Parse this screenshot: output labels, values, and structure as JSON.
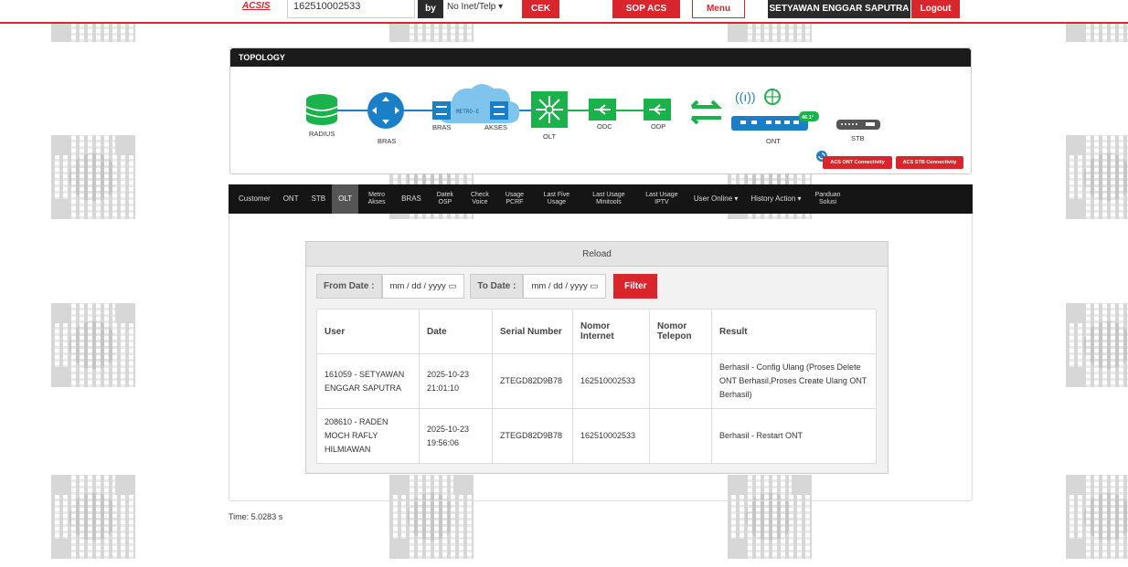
{
  "header": {
    "logo": "ACSIS",
    "search_value": "162510002533",
    "by_label": "by",
    "by_select": "No Inet/Telp ▾",
    "cek_label": "CEK",
    "sop_label": "SOP ACS",
    "menu_label": "Menu",
    "user_name": "SETYAWAN ENGGAR SAPUTRA",
    "logout_label": "Logout"
  },
  "topology": {
    "title": "TOPOLOGY",
    "nodes": {
      "radius": "RADIUS",
      "bras": "BRAS",
      "bras2": "BRAS",
      "metro": "METRO-E",
      "akses": "AKSES",
      "olt": "OLT",
      "odc": "ODC",
      "odp": "ODP",
      "ont": "ONT",
      "stb": "STB",
      "ont_badge": "46.1°"
    },
    "acs_ont_label": "ACS ONT Connectivity",
    "acs_stb_label": "ACS STB Connectivity"
  },
  "nav": {
    "items": [
      {
        "label": "Customer"
      },
      {
        "label": "ONT"
      },
      {
        "label": "STB"
      },
      {
        "label": "OLT"
      },
      {
        "label": "Metro Akses"
      },
      {
        "label": "BRAS"
      },
      {
        "label": "Datek OSP"
      },
      {
        "label": "Check Voice"
      },
      {
        "label": "Usage PCRF"
      },
      {
        "label": "Last Five Usage"
      },
      {
        "label": "Last Usage Minitools"
      },
      {
        "label": "Last Usage IPTV"
      },
      {
        "label": "User Online ▾"
      },
      {
        "label": "History Action ▾"
      },
      {
        "label": "Panduan Solusi"
      }
    ],
    "active": "OLT"
  },
  "panel": {
    "reload": "Reload",
    "from_label": "From Date :",
    "from_placeholder": "mm / dd / yyyy",
    "to_label": "To Date :",
    "to_placeholder": "mm / dd / yyyy",
    "filter_label": "Filter"
  },
  "table": {
    "headers": [
      "User",
      "Date",
      "Serial Number",
      "Nomor Internet",
      "Nomor Telepon",
      "Result"
    ],
    "rows": [
      [
        "161059 - SETYAWAN ENGGAR SAPUTRA",
        "2025-10-23 21:01:10",
        "ZTEGD82D9B78",
        "162510002533",
        "",
        "Berhasil - Config Ulang (Proses Delete ONT Berhasil,Proses Create Ulang ONT Berhasil)"
      ],
      [
        "208610 - RADEN MOCH RAFLY HILMIAWAN",
        "2025-10-23 19:56:06",
        "ZTEGD82D9B78",
        "162510002533",
        "",
        "Berhasil - Restart ONT"
      ]
    ]
  },
  "footer": {
    "time": "Time: 5.0283 s"
  },
  "colors": {
    "brand_red": "#d9262c",
    "node_blue": "#1a7fc7",
    "node_green": "#19b24b",
    "dark": "#151515"
  }
}
